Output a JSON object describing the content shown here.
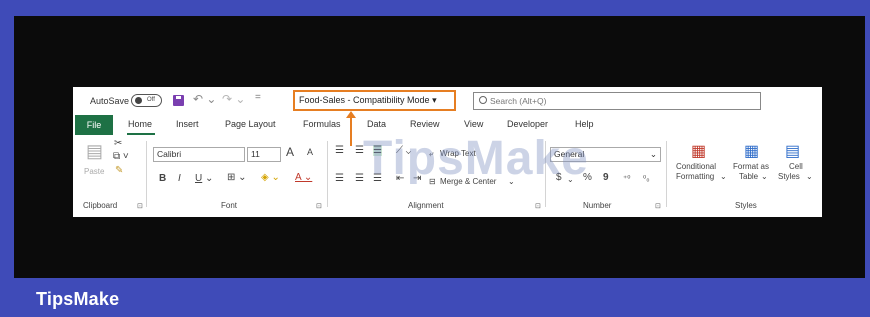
{
  "brand": {
    "name": "TipsMake",
    "watermark": "TipsMake"
  },
  "titlebar": {
    "autosave_label": "AutoSave",
    "autosave_state": "Off",
    "undo_icon": "undo-icon",
    "redo_icon": "redo-icon",
    "qat_more": "=",
    "document_title": "Food-Sales - Compatibility Mode",
    "search_placeholder": "Search (Alt+Q)",
    "highlight_color": "#e67e22"
  },
  "tabs": [
    {
      "label": "File"
    },
    {
      "label": "Home"
    },
    {
      "label": "Insert"
    },
    {
      "label": "Page Layout"
    },
    {
      "label": "Formulas"
    },
    {
      "label": "Data"
    },
    {
      "label": "Review"
    },
    {
      "label": "View"
    },
    {
      "label": "Developer"
    },
    {
      "label": "Help"
    }
  ],
  "ribbon": {
    "clipboard": {
      "paste": "Paste",
      "label": "Clipboard"
    },
    "font": {
      "name": "Calibri",
      "size": "11",
      "bold": "B",
      "italic": "I",
      "underline": "U",
      "grow": "A",
      "shrink": "A",
      "label": "Font"
    },
    "alignment": {
      "wrap_text": "Wrap Text",
      "merge_center": "Merge & Center",
      "label": "Alignment"
    },
    "number": {
      "format": "General",
      "currency": "$",
      "percent": "%",
      "comma": "9",
      "label": "Number"
    },
    "styles": {
      "conditional_1": "Conditional",
      "conditional_2": "Formatting",
      "format_table_1": "Format as",
      "format_table_2": "Table",
      "cell_styles_1": "Cell",
      "cell_styles_2": "Styles",
      "label": "Styles"
    }
  },
  "colors": {
    "excel_green": "#1e7145",
    "frame_blue": "#3f4bb8",
    "background": "#0b0b0b"
  }
}
